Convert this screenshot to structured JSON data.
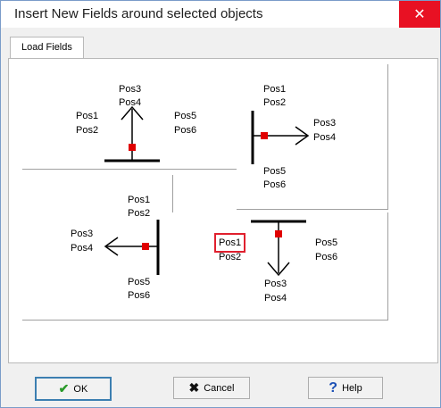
{
  "window": {
    "title": "Insert New Fields around selected objects",
    "close_glyph": "✕"
  },
  "tabs": [
    {
      "label": "Load Fields"
    }
  ],
  "positions": {
    "top": {
      "pos1": "Pos1",
      "pos2": "Pos2",
      "pos3": "Pos3",
      "pos4": "Pos4",
      "pos5": "Pos5",
      "pos6": "Pos6"
    },
    "right": {
      "pos1": "Pos1",
      "pos2": "Pos2",
      "pos3": "Pos3",
      "pos4": "Pos4",
      "pos5": "Pos5",
      "pos6": "Pos6"
    },
    "left": {
      "pos1": "Pos1",
      "pos2": "Pos2",
      "pos3": "Pos3",
      "pos4": "Pos4",
      "pos5": "Pos5",
      "pos6": "Pos6"
    },
    "bottom": {
      "pos1": "Pos1",
      "pos2": "Pos2",
      "pos3": "Pos3",
      "pos4": "Pos4",
      "pos5": "Pos5",
      "pos6": "Pos6"
    }
  },
  "selected_position": "bottom.pos1",
  "buttons": {
    "ok": {
      "label": "OK",
      "icon": "checkmark-icon"
    },
    "cancel": {
      "label": "Cancel",
      "icon": "x-icon"
    },
    "help": {
      "label": "Help",
      "icon": "question-icon"
    }
  },
  "colors": {
    "anchor": "#e00000",
    "selection": "#e0202e",
    "check": "#2a9a2a",
    "help": "#1a4fb5",
    "close_bg": "#e81123"
  }
}
